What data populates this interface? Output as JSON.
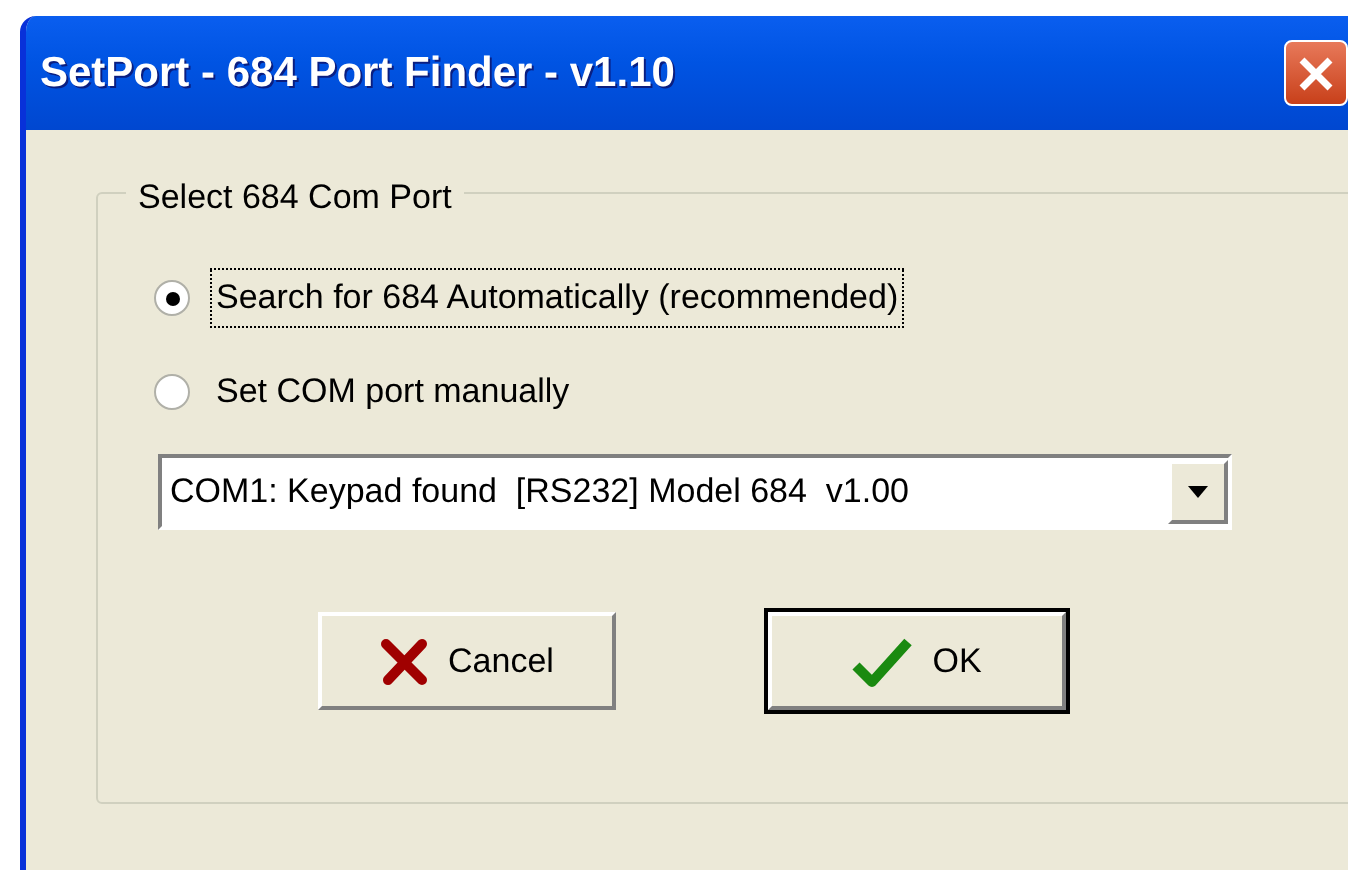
{
  "window": {
    "title": "SetPort - 684 Port Finder - v1.10"
  },
  "group": {
    "legend": "Select 684 Com Port"
  },
  "radios": [
    {
      "label": "Search for 684 Automatically (recommended)",
      "selected": true,
      "focused": true
    },
    {
      "label": "Set COM port manually",
      "selected": false,
      "focused": false
    }
  ],
  "dropdown": {
    "value": "COM1: Keypad found  [RS232] Model 684  v1.00"
  },
  "buttons": [
    {
      "kind": "cancel",
      "label": "Cancel",
      "default": false
    },
    {
      "kind": "ok",
      "label": "OK",
      "default": true
    }
  ]
}
